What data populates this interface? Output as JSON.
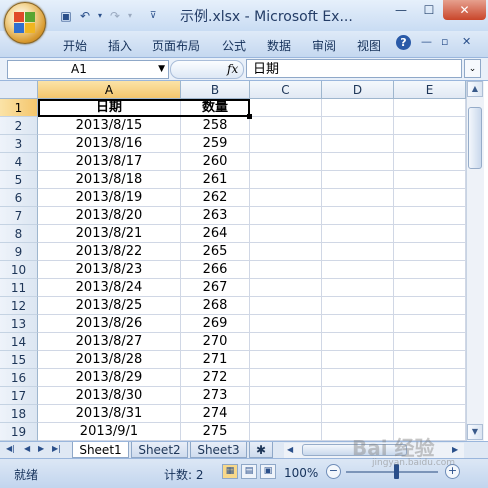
{
  "window": {
    "title": "示例.xlsx - Microsoft Ex...",
    "min_label": "—",
    "max_label": "☐",
    "close_label": "✕"
  },
  "quick_access": {
    "save_icon": "save-icon",
    "undo_icon": "undo-icon",
    "redo_icon": "redo-icon",
    "customize_icon": "customize-icon"
  },
  "ribbon": {
    "tabs": [
      {
        "label": "开始"
      },
      {
        "label": "插入"
      },
      {
        "label": "页面布局"
      },
      {
        "label": "公式"
      },
      {
        "label": "数据"
      },
      {
        "label": "审阅"
      },
      {
        "label": "视图"
      }
    ],
    "help_label": "?"
  },
  "formula_bar": {
    "name_box": "A1",
    "fx_label": "fx",
    "content": "日期"
  },
  "columns": [
    "A",
    "B",
    "C",
    "D",
    "E"
  ],
  "selected_column": "A",
  "rows": [
    {
      "num": "1",
      "a": "日期",
      "b": "数量",
      "header": true
    },
    {
      "num": "2",
      "a": "2013/8/15",
      "b": "258"
    },
    {
      "num": "3",
      "a": "2013/8/16",
      "b": "259"
    },
    {
      "num": "4",
      "a": "2013/8/17",
      "b": "260"
    },
    {
      "num": "5",
      "a": "2013/8/18",
      "b": "261"
    },
    {
      "num": "6",
      "a": "2013/8/19",
      "b": "262"
    },
    {
      "num": "7",
      "a": "2013/8/20",
      "b": "263"
    },
    {
      "num": "8",
      "a": "2013/8/21",
      "b": "264"
    },
    {
      "num": "9",
      "a": "2013/8/22",
      "b": "265"
    },
    {
      "num": "10",
      "a": "2013/8/23",
      "b": "266"
    },
    {
      "num": "11",
      "a": "2013/8/24",
      "b": "267"
    },
    {
      "num": "12",
      "a": "2013/8/25",
      "b": "268"
    },
    {
      "num": "13",
      "a": "2013/8/26",
      "b": "269"
    },
    {
      "num": "14",
      "a": "2013/8/27",
      "b": "270"
    },
    {
      "num": "15",
      "a": "2013/8/28",
      "b": "271"
    },
    {
      "num": "16",
      "a": "2013/8/29",
      "b": "272"
    },
    {
      "num": "17",
      "a": "2013/8/30",
      "b": "273"
    },
    {
      "num": "18",
      "a": "2013/8/31",
      "b": "274"
    },
    {
      "num": "19",
      "a": "2013/9/1",
      "b": "275"
    }
  ],
  "sheets": [
    {
      "label": "Sheet1",
      "active": true
    },
    {
      "label": "Sheet2",
      "active": false
    },
    {
      "label": "Sheet3",
      "active": false
    }
  ],
  "status": {
    "ready": "就绪",
    "count": "计数: 2",
    "zoom": "100%"
  },
  "watermark": {
    "main": "Bai 经验",
    "sub": "jingyan.baidu.com"
  },
  "colors": {
    "selected_header": "#f4c66d",
    "ribbon": "#c5d8f0",
    "gridline": "#d0d7e5"
  }
}
